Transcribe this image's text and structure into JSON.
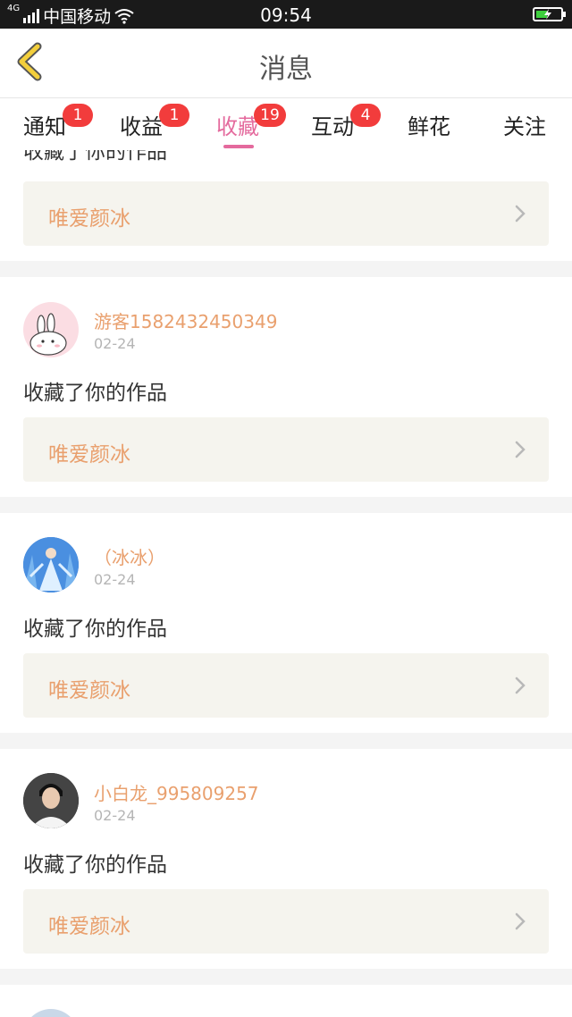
{
  "status_bar": {
    "network": "4G",
    "carrier": "中国移动",
    "time": "09:54"
  },
  "header": {
    "title": "消息"
  },
  "tabs": [
    {
      "label": "通知",
      "badge": "1"
    },
    {
      "label": "收益",
      "badge": "1"
    },
    {
      "label": "收藏",
      "badge": "19",
      "active": true
    },
    {
      "label": "互动",
      "badge": "4"
    },
    {
      "label": "鲜花"
    },
    {
      "label": "关注"
    }
  ],
  "colors": {
    "accent": "#e46a9d",
    "username": "#e9a06e",
    "badge": "#f23c3c"
  },
  "feed": [
    {
      "action": "收藏了你的作品",
      "work_title": "唯爱颜冰"
    },
    {
      "username": "游客1582432450349",
      "date": "02-24",
      "action": "收藏了你的作品",
      "work_title": "唯爱颜冰",
      "avatar_icon": "bunny-avatar"
    },
    {
      "username": "（冰冰）",
      "date": "02-24",
      "action": "收藏了你的作品",
      "work_title": "唯爱颜冰",
      "avatar_icon": "ice-princess-avatar"
    },
    {
      "username": "小白龙_995809257",
      "date": "02-24",
      "action": "收藏了你的作品",
      "work_title": "唯爱颜冰",
      "avatar_icon": "portrait-avatar"
    }
  ]
}
